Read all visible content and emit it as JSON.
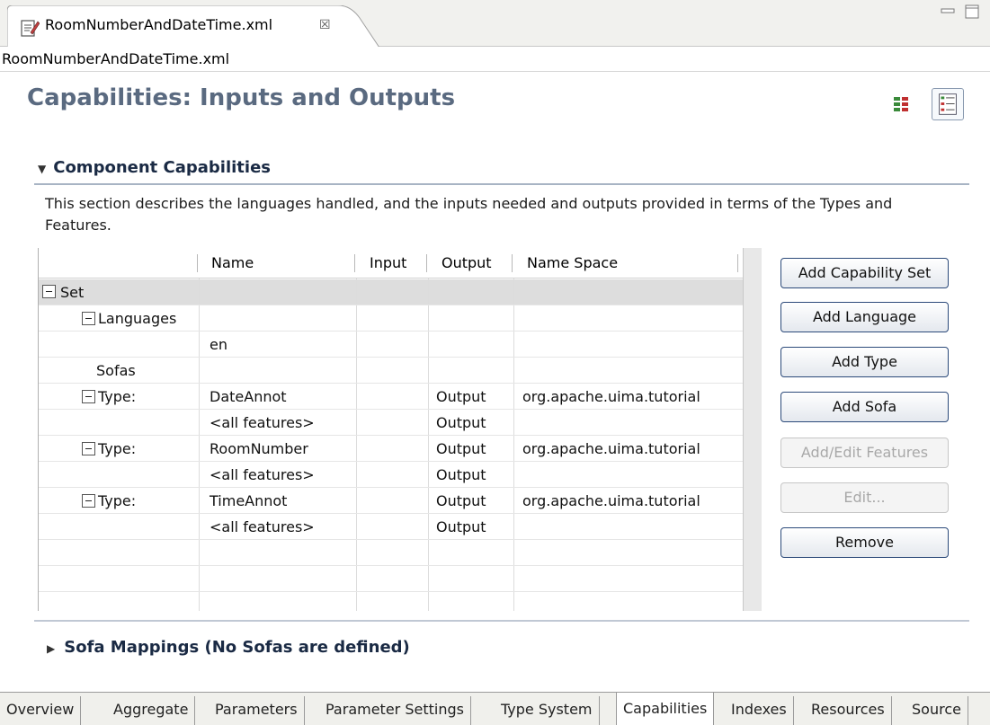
{
  "editor_tab": {
    "title": "RoomNumberAndDateTime.xml",
    "close_glyph": "☒"
  },
  "filename": "RoomNumberAndDateTime.xml",
  "page_title": "Capabilities: Inputs and Outputs",
  "section": {
    "title": "Component Capabilities",
    "description": "This section describes the languages handled, and the inputs needed and outputs provided in terms of the Types and Features."
  },
  "table": {
    "columns": [
      "Name",
      "Input",
      "Output",
      "Name Space"
    ],
    "rows": [
      {
        "label": "Set",
        "name": "",
        "input": "",
        "output": "",
        "namespace": ""
      },
      {
        "label": "Languages",
        "name": "",
        "input": "",
        "output": "",
        "namespace": ""
      },
      {
        "label": "",
        "name": "en",
        "input": "",
        "output": "",
        "namespace": ""
      },
      {
        "label": "Sofas",
        "name": "",
        "input": "",
        "output": "",
        "namespace": ""
      },
      {
        "label": "Type:",
        "name": "DateAnnot",
        "input": "",
        "output": "Output",
        "namespace": "org.apache.uima.tutorial"
      },
      {
        "label": "",
        "name": "<all features>",
        "input": "",
        "output": "Output",
        "namespace": ""
      },
      {
        "label": "Type:",
        "name": "RoomNumber",
        "input": "",
        "output": "Output",
        "namespace": "org.apache.uima.tutorial"
      },
      {
        "label": "",
        "name": "<all features>",
        "input": "",
        "output": "Output",
        "namespace": ""
      },
      {
        "label": "Type:",
        "name": "TimeAnnot",
        "input": "",
        "output": "Output",
        "namespace": "org.apache.uima.tutorial"
      },
      {
        "label": "",
        "name": "<all features>",
        "input": "",
        "output": "Output",
        "namespace": ""
      }
    ]
  },
  "buttons": {
    "add_capability_set": "Add Capability Set",
    "add_language": "Add Language",
    "add_type": "Add Type",
    "add_sofa": "Add Sofa",
    "add_edit_features": "Add/Edit Features",
    "edit": "Edit...",
    "remove": "Remove"
  },
  "sofa_section": {
    "title": "Sofa Mappings (No Sofas are defined)"
  },
  "page_tabs": [
    "Overview",
    "Aggregate",
    "Parameters",
    "Parameter Settings",
    "Type System",
    "Capabilities",
    "Indexes",
    "Resources",
    "Source"
  ],
  "active_tab": "Capabilities",
  "colors": {
    "title": "#5a6a80",
    "section": "#1a2a44",
    "button_border": "#2c4a7a"
  }
}
